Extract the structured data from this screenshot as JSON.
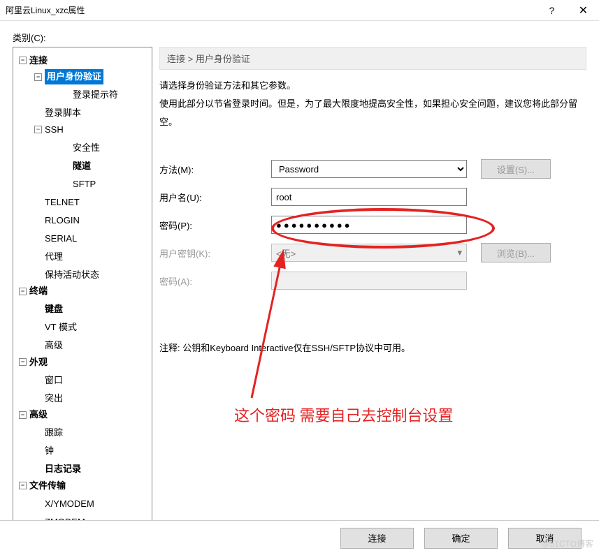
{
  "titlebar": {
    "title": "阿里云Linux_xzc属性"
  },
  "category_label": "类别(C):",
  "tree": {
    "connection": {
      "label": "连接",
      "children": {
        "auth": {
          "label": "用户身份验证",
          "children": {
            "prompt": {
              "label": "登录提示符"
            }
          }
        },
        "script": {
          "label": "登录脚本"
        },
        "ssh": {
          "label": "SSH",
          "children": {
            "security": {
              "label": "安全性"
            },
            "tunnel": {
              "label": "隧道"
            },
            "sftp": {
              "label": "SFTP"
            }
          }
        },
        "telnet": {
          "label": "TELNET"
        },
        "rlogin": {
          "label": "RLOGIN"
        },
        "serial": {
          "label": "SERIAL"
        },
        "proxy": {
          "label": "代理"
        },
        "keepalive": {
          "label": "保持活动状态"
        }
      }
    },
    "terminal": {
      "label": "终端",
      "children": {
        "keyboard": {
          "label": "键盘"
        },
        "vtmode": {
          "label": "VT 模式"
        },
        "advanced": {
          "label": "高级"
        }
      }
    },
    "appearance": {
      "label": "外观",
      "children": {
        "window": {
          "label": "窗口"
        },
        "highlight": {
          "label": "突出"
        }
      }
    },
    "advanced": {
      "label": "高级",
      "children": {
        "trace": {
          "label": "跟踪"
        },
        "bell": {
          "label": "钟"
        },
        "log": {
          "label": "日志记录"
        }
      }
    },
    "filetransfer": {
      "label": "文件传输",
      "children": {
        "xymodem": {
          "label": "X/YMODEM"
        },
        "zmodem": {
          "label": "ZMODEM"
        }
      }
    }
  },
  "breadcrumb": "连接 > 用户身份验证",
  "description": {
    "line1": "请选择身份验证方法和其它参数。",
    "line2": "使用此部分以节省登录时间。但是，为了最大限度地提高安全性，如果担心安全问题，建议您将此部分留空。"
  },
  "form": {
    "method": {
      "label": "方法(M):",
      "value": "Password",
      "button": "设置(S)..."
    },
    "username": {
      "label": "用户名(U):",
      "value": "root"
    },
    "password": {
      "label": "密码(P):",
      "value": "●●●●●●●●●●"
    },
    "userkey": {
      "label": "用户密钥(K):",
      "value": "<无>",
      "button": "浏览(B)..."
    },
    "keypassword": {
      "label": "密码(A):"
    }
  },
  "note": "注释: 公钥和Keyboard Interactive仅在SSH/SFTP协议中可用。",
  "annotation": "这个密码  需要自己去控制台设置",
  "footer": {
    "connect": "连接",
    "ok": "确定",
    "cancel": "取消"
  },
  "watermark": "@51CTO博客"
}
